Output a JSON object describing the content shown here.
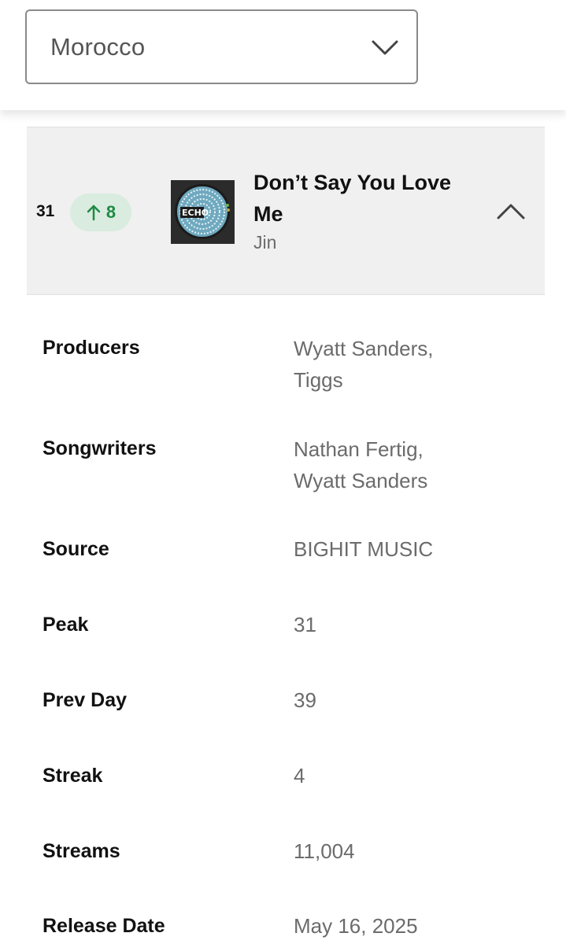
{
  "country_select": {
    "value": "Morocco"
  },
  "track": {
    "rank": "31",
    "change": "8",
    "change_direction": "up",
    "title": "Don’t Say You Love Me",
    "artist": "Jin",
    "cover_text": "ECHO"
  },
  "details": {
    "producers_label": "Producers",
    "producers_line1": "Wyatt Sanders,",
    "producers_line2": "Tiggs",
    "songwriters_label": "Songwriters",
    "songwriters_line1": "Nathan Fertig,",
    "songwriters_line2": "Wyatt Sanders",
    "source_label": "Source",
    "source_value": "BIGHIT MUSIC",
    "peak_label": "Peak",
    "peak_value": "31",
    "prev_day_label": "Prev Day",
    "prev_day_value": "39",
    "streak_label": "Streak",
    "streak_value": "4",
    "streams_label": "Streams",
    "streams_value": "11,004",
    "release_date_label": "Release Date",
    "release_date_value": "May 16, 2025"
  },
  "colors": {
    "badge_bg": "#d9ecdf",
    "badge_fg": "#1e8a44",
    "row_bg": "#f0f0f0"
  },
  "icons": {
    "dropdown": "chevron-down-icon",
    "change": "arrow-up-icon",
    "collapse": "chevron-up-icon"
  }
}
